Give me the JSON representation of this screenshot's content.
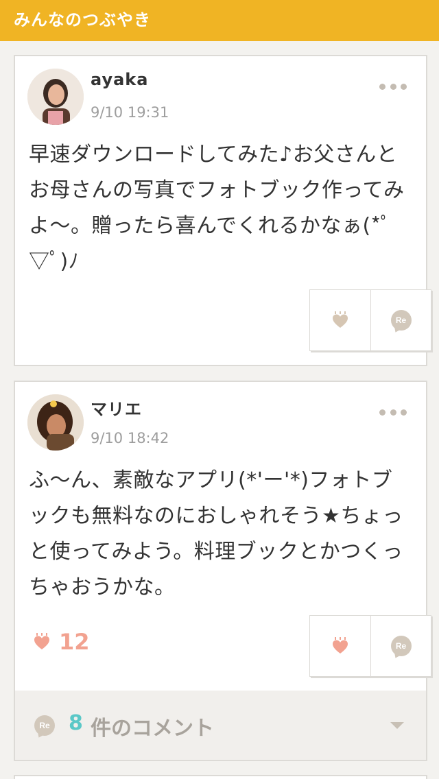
{
  "header": {
    "title": "みんなのつぶやき"
  },
  "posts": [
    {
      "username": "ayaka",
      "timestamp": "9/10 19:31",
      "text": "早速ダウンロードしてみた♪お父さんとお母さんの写真でフォトブック作ってみよ〜。贈ったら喜んでくれるかなぁ(*ﾟ▽ﾟ)ﾉ",
      "like_icon_color": "#d6c6b3",
      "reply_label": "Re"
    },
    {
      "username": "マリエ",
      "timestamp": "9/10 18:42",
      "text": "ふ〜ん、素敵なアプリ(*'ー'*)フォトブックも無料なのにおしゃれそう★ちょっと使ってみよう。料理ブックとかつくっちゃおうかな。",
      "like_count": "12",
      "like_icon_color": "#f2a290",
      "reply_label": "Re",
      "comments": {
        "count": "8",
        "label": "件のコメント",
        "icon_label": "Re"
      }
    }
  ],
  "colors": {
    "header": "#f0b424",
    "like_active": "#f2a290",
    "comment_count": "#5bc8c7"
  }
}
